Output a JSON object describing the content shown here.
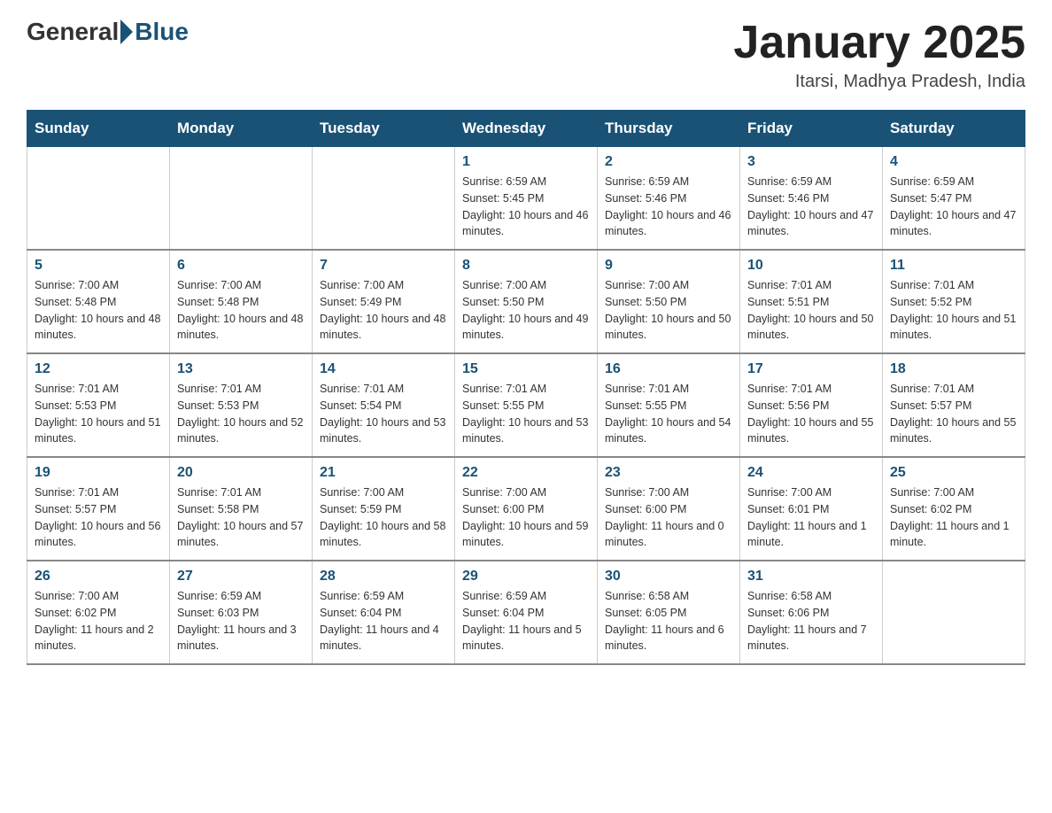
{
  "logo": {
    "general": "General",
    "blue": "Blue",
    "subtitle": ""
  },
  "title": "January 2025",
  "location": "Itarsi, Madhya Pradesh, India",
  "headers": [
    "Sunday",
    "Monday",
    "Tuesday",
    "Wednesday",
    "Thursday",
    "Friday",
    "Saturday"
  ],
  "weeks": [
    [
      {
        "day": "",
        "info": ""
      },
      {
        "day": "",
        "info": ""
      },
      {
        "day": "",
        "info": ""
      },
      {
        "day": "1",
        "info": "Sunrise: 6:59 AM\nSunset: 5:45 PM\nDaylight: 10 hours and 46 minutes."
      },
      {
        "day": "2",
        "info": "Sunrise: 6:59 AM\nSunset: 5:46 PM\nDaylight: 10 hours and 46 minutes."
      },
      {
        "day": "3",
        "info": "Sunrise: 6:59 AM\nSunset: 5:46 PM\nDaylight: 10 hours and 47 minutes."
      },
      {
        "day": "4",
        "info": "Sunrise: 6:59 AM\nSunset: 5:47 PM\nDaylight: 10 hours and 47 minutes."
      }
    ],
    [
      {
        "day": "5",
        "info": "Sunrise: 7:00 AM\nSunset: 5:48 PM\nDaylight: 10 hours and 48 minutes."
      },
      {
        "day": "6",
        "info": "Sunrise: 7:00 AM\nSunset: 5:48 PM\nDaylight: 10 hours and 48 minutes."
      },
      {
        "day": "7",
        "info": "Sunrise: 7:00 AM\nSunset: 5:49 PM\nDaylight: 10 hours and 48 minutes."
      },
      {
        "day": "8",
        "info": "Sunrise: 7:00 AM\nSunset: 5:50 PM\nDaylight: 10 hours and 49 minutes."
      },
      {
        "day": "9",
        "info": "Sunrise: 7:00 AM\nSunset: 5:50 PM\nDaylight: 10 hours and 50 minutes."
      },
      {
        "day": "10",
        "info": "Sunrise: 7:01 AM\nSunset: 5:51 PM\nDaylight: 10 hours and 50 minutes."
      },
      {
        "day": "11",
        "info": "Sunrise: 7:01 AM\nSunset: 5:52 PM\nDaylight: 10 hours and 51 minutes."
      }
    ],
    [
      {
        "day": "12",
        "info": "Sunrise: 7:01 AM\nSunset: 5:53 PM\nDaylight: 10 hours and 51 minutes."
      },
      {
        "day": "13",
        "info": "Sunrise: 7:01 AM\nSunset: 5:53 PM\nDaylight: 10 hours and 52 minutes."
      },
      {
        "day": "14",
        "info": "Sunrise: 7:01 AM\nSunset: 5:54 PM\nDaylight: 10 hours and 53 minutes."
      },
      {
        "day": "15",
        "info": "Sunrise: 7:01 AM\nSunset: 5:55 PM\nDaylight: 10 hours and 53 minutes."
      },
      {
        "day": "16",
        "info": "Sunrise: 7:01 AM\nSunset: 5:55 PM\nDaylight: 10 hours and 54 minutes."
      },
      {
        "day": "17",
        "info": "Sunrise: 7:01 AM\nSunset: 5:56 PM\nDaylight: 10 hours and 55 minutes."
      },
      {
        "day": "18",
        "info": "Sunrise: 7:01 AM\nSunset: 5:57 PM\nDaylight: 10 hours and 55 minutes."
      }
    ],
    [
      {
        "day": "19",
        "info": "Sunrise: 7:01 AM\nSunset: 5:57 PM\nDaylight: 10 hours and 56 minutes."
      },
      {
        "day": "20",
        "info": "Sunrise: 7:01 AM\nSunset: 5:58 PM\nDaylight: 10 hours and 57 minutes."
      },
      {
        "day": "21",
        "info": "Sunrise: 7:00 AM\nSunset: 5:59 PM\nDaylight: 10 hours and 58 minutes."
      },
      {
        "day": "22",
        "info": "Sunrise: 7:00 AM\nSunset: 6:00 PM\nDaylight: 10 hours and 59 minutes."
      },
      {
        "day": "23",
        "info": "Sunrise: 7:00 AM\nSunset: 6:00 PM\nDaylight: 11 hours and 0 minutes."
      },
      {
        "day": "24",
        "info": "Sunrise: 7:00 AM\nSunset: 6:01 PM\nDaylight: 11 hours and 1 minute."
      },
      {
        "day": "25",
        "info": "Sunrise: 7:00 AM\nSunset: 6:02 PM\nDaylight: 11 hours and 1 minute."
      }
    ],
    [
      {
        "day": "26",
        "info": "Sunrise: 7:00 AM\nSunset: 6:02 PM\nDaylight: 11 hours and 2 minutes."
      },
      {
        "day": "27",
        "info": "Sunrise: 6:59 AM\nSunset: 6:03 PM\nDaylight: 11 hours and 3 minutes."
      },
      {
        "day": "28",
        "info": "Sunrise: 6:59 AM\nSunset: 6:04 PM\nDaylight: 11 hours and 4 minutes."
      },
      {
        "day": "29",
        "info": "Sunrise: 6:59 AM\nSunset: 6:04 PM\nDaylight: 11 hours and 5 minutes."
      },
      {
        "day": "30",
        "info": "Sunrise: 6:58 AM\nSunset: 6:05 PM\nDaylight: 11 hours and 6 minutes."
      },
      {
        "day": "31",
        "info": "Sunrise: 6:58 AM\nSunset: 6:06 PM\nDaylight: 11 hours and 7 minutes."
      },
      {
        "day": "",
        "info": ""
      }
    ]
  ]
}
